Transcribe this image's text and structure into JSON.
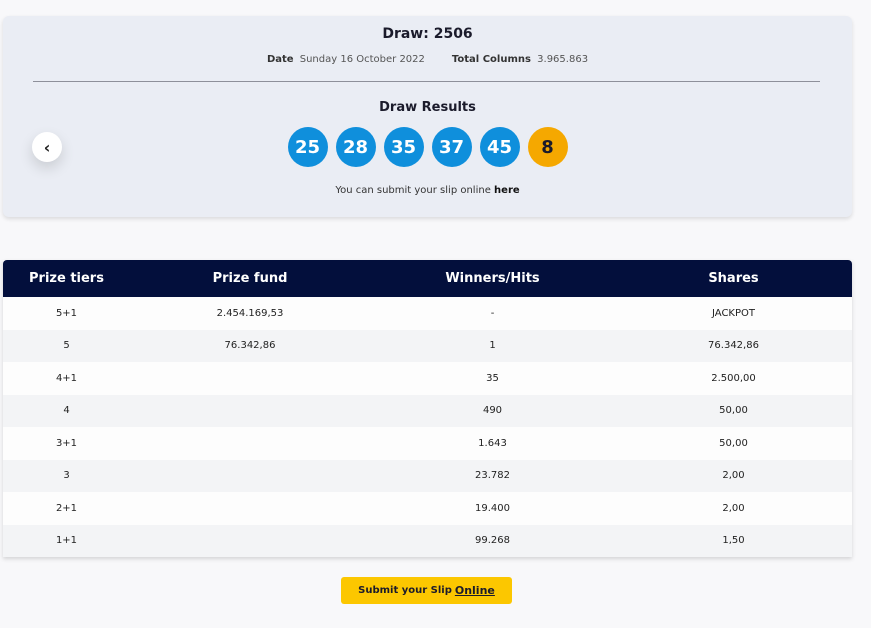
{
  "draw": {
    "title": "Draw: 2506",
    "date_label": "Date",
    "date_value": "Sunday 16 October 2022",
    "columns_label": "Total Columns",
    "columns_value": "3.965.863",
    "results_title": "Draw Results",
    "numbers": [
      "25",
      "28",
      "35",
      "37",
      "45"
    ],
    "bonus": "8",
    "prev_icon": "‹",
    "submit_prefix": "You can submit your slip online",
    "submit_link": "here",
    "colors": {
      "ball": "#0f8fdc",
      "bonus": "#f5a800",
      "card_bg": "#eaedf4"
    }
  },
  "table": {
    "headers": [
      "Prize tiers",
      "Prize fund",
      "Winners/Hits",
      "Shares"
    ],
    "rows": [
      [
        "5+1",
        "2.454.169,53",
        "-",
        "JACKPOT"
      ],
      [
        "5",
        "76.342,86",
        "1",
        "76.342,86"
      ],
      [
        "4+1",
        "",
        "35",
        "2.500,00"
      ],
      [
        "4",
        "",
        "490",
        "50,00"
      ],
      [
        "3+1",
        "",
        "1.643",
        "50,00"
      ],
      [
        "3",
        "",
        "23.782",
        "2,00"
      ],
      [
        "2+1",
        "",
        "19.400",
        "2,00"
      ],
      [
        "1+1",
        "",
        "99.268",
        "1,50"
      ]
    ],
    "colors": {
      "header_bg": "#030f3c"
    }
  },
  "cta": {
    "prefix": "Submit your Slip",
    "link": "Online",
    "color": "#fcc700"
  }
}
